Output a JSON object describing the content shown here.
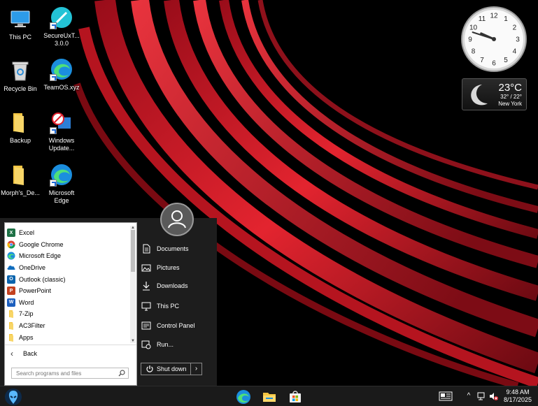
{
  "desktop": {
    "icons": [
      {
        "label": "This PC"
      },
      {
        "label": "SecureUxT...\n3.0.0"
      },
      {
        "label": "Recycle Bin"
      },
      {
        "label": "TeamOS.xyz"
      },
      {
        "label": "Backup"
      },
      {
        "label": "Windows\nUpdate..."
      },
      {
        "label": "Morph's_De..."
      },
      {
        "label": "Microsoft\nEdge"
      }
    ]
  },
  "clock": {
    "numbers": [
      "12",
      "1",
      "2",
      "3",
      "4",
      "5",
      "6",
      "7",
      "8",
      "9",
      "10",
      "11"
    ],
    "hour": 9,
    "minute": 48
  },
  "weather": {
    "temp": "23°C",
    "range": "32° / 22°",
    "city": "New York"
  },
  "start_menu": {
    "programs": [
      {
        "label": "Excel",
        "icon": "excel-icon",
        "color": "#1d7044",
        "glyph": "X"
      },
      {
        "label": "Google Chrome",
        "icon": "chrome-icon",
        "color": "#4285f4",
        "glyph": ""
      },
      {
        "label": "Microsoft Edge",
        "icon": "edge-icon",
        "color": "#0f8ad6",
        "glyph": ""
      },
      {
        "label": "OneDrive",
        "icon": "onedrive-icon",
        "color": "#0f6cbd",
        "glyph": ""
      },
      {
        "label": "Outlook (classic)",
        "icon": "outlook-icon",
        "color": "#0a64ad",
        "glyph": "O"
      },
      {
        "label": "PowerPoint",
        "icon": "powerpoint-icon",
        "color": "#c4411f",
        "glyph": "P"
      },
      {
        "label": "Word",
        "icon": "word-icon",
        "color": "#1b5ebe",
        "glyph": "W"
      },
      {
        "label": "7-Zip",
        "icon": "folder-icon",
        "color": "#f2c84b",
        "glyph": ""
      },
      {
        "label": "AC3Filter",
        "icon": "folder-icon",
        "color": "#f2c84b",
        "glyph": ""
      },
      {
        "label": "Apps",
        "icon": "folder-icon",
        "color": "#f2c84b",
        "glyph": ""
      }
    ],
    "back_label": "Back",
    "search_placeholder": "Search programs and files",
    "right_items": [
      {
        "label": "Documents",
        "icon": "documents-icon"
      },
      {
        "label": "Pictures",
        "icon": "pictures-icon"
      },
      {
        "label": "Downloads",
        "icon": "downloads-icon"
      },
      {
        "label": "This PC",
        "icon": "computer-icon"
      },
      {
        "label": "Control Panel",
        "icon": "control-panel-icon"
      },
      {
        "label": "Run...",
        "icon": "run-icon"
      }
    ],
    "shutdown_label": "Shut down"
  },
  "taskbar": {
    "time": "9:48 AM",
    "date": "8/17/2025"
  },
  "colors": {
    "wallpaper_red": "#e0202c",
    "taskbar_bg": "#1a1a1a",
    "menu_bg": "#1d1d1d"
  }
}
